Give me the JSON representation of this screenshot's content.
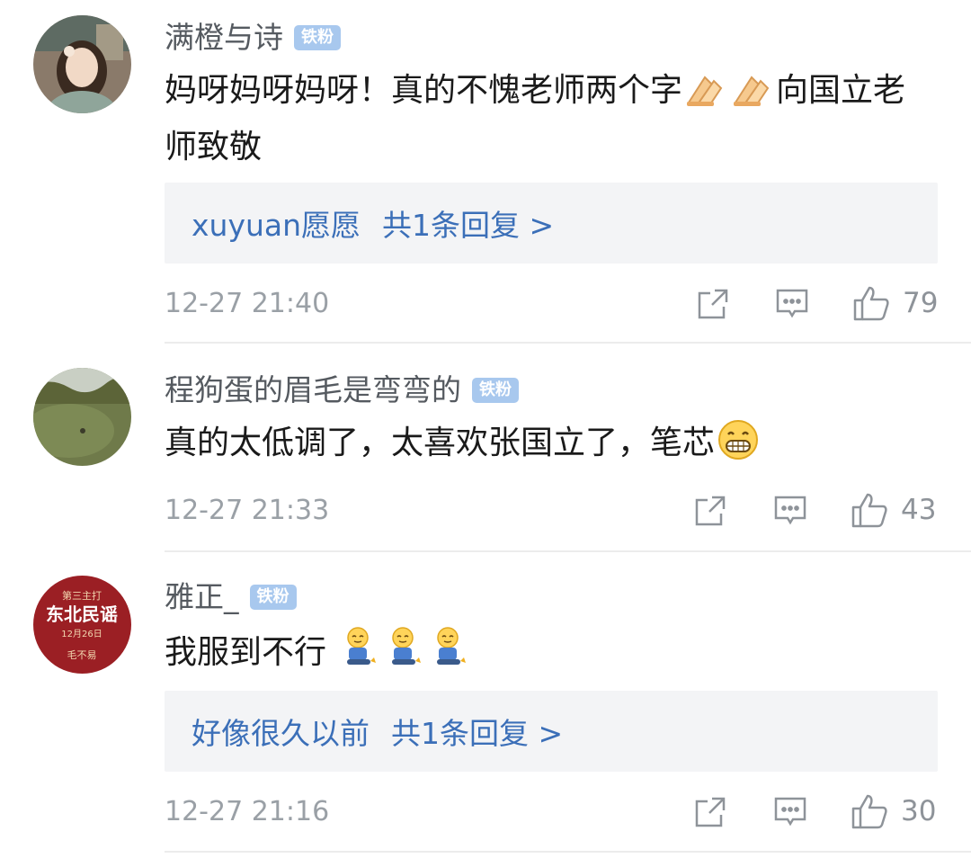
{
  "comments": [
    {
      "username": "满橙与诗",
      "badge": "铁粉",
      "text_before_emoji": "妈呀妈呀妈呀！真的不愧老师两个字",
      "text_after_emoji": "向国立老师致敬",
      "emojis": [
        "pray-hands-icon",
        "pray-hands-icon"
      ],
      "reply": {
        "name": "xuyuan愿愿",
        "count_text": "共1条回复 >"
      },
      "time": "12-27 21:40",
      "likes": "79"
    },
    {
      "username": "程狗蛋的眉毛是弯弯的",
      "badge": "铁粉",
      "text_before_emoji": "真的太低调了，太喜欢张国立了，笔芯",
      "text_after_emoji": "",
      "emojis": [
        "grin-face-icon"
      ],
      "time": "12-27 21:33",
      "likes": "43"
    },
    {
      "username": "雅正_",
      "badge": "铁粉",
      "text_before_emoji": "我服到不行",
      "text_after_emoji": "",
      "emojis": [
        "kneel-icon",
        "kneel-icon",
        "kneel-icon"
      ],
      "avatar_text": {
        "line1": "第三主打",
        "line2": "东北民谣",
        "line3": "12月26日",
        "line4": "毛不易"
      },
      "reply": {
        "name": "好像很久以前",
        "count_text": "共1条回复 >"
      },
      "time": "12-27 21:16",
      "likes": "30"
    }
  ],
  "colors": {
    "link": "#3b6fb8",
    "badge": "#a8c8ee",
    "muted": "#9aa0a6"
  }
}
